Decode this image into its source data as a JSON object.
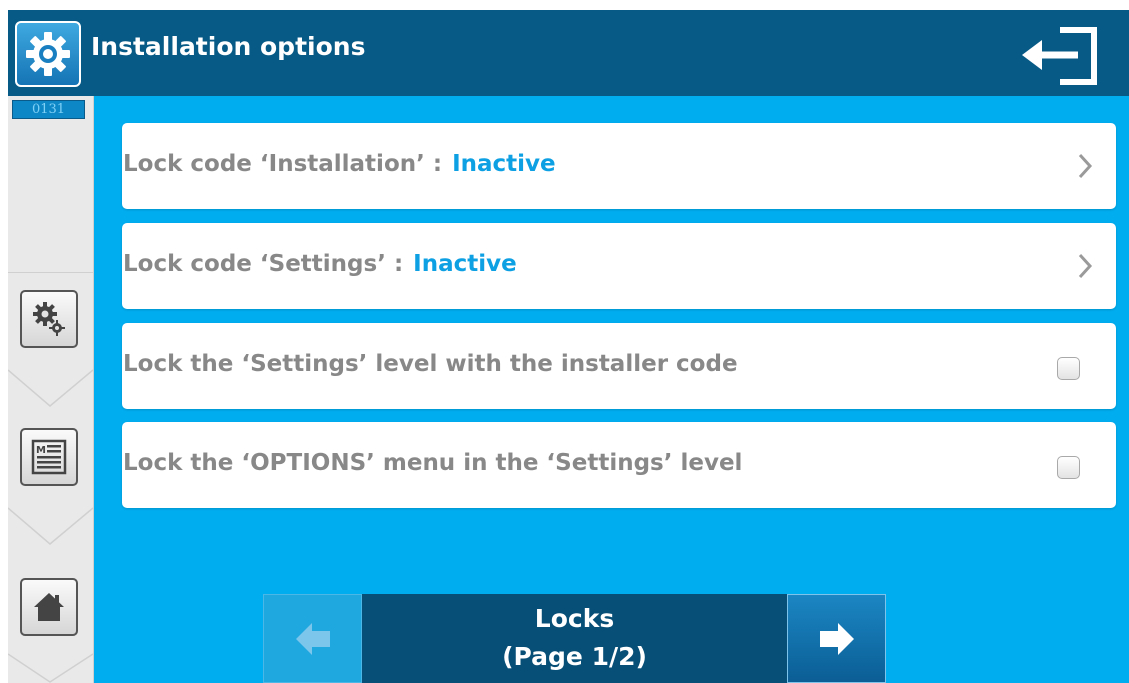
{
  "header": {
    "title": "Installation options",
    "settings_icon": "gear-icon",
    "exit_icon": "exit-icon"
  },
  "sidebar": {
    "code": "0131",
    "tabs": [
      {
        "name": "settings",
        "icon": "gears-icon"
      },
      {
        "name": "menu",
        "icon": "menu-list-icon"
      },
      {
        "name": "home",
        "icon": "home-icon"
      }
    ]
  },
  "options": [
    {
      "label": "Lock code ‘Installation’ :",
      "value": "Inactive",
      "control": "chevron"
    },
    {
      "label": "Lock code ‘Settings’ :",
      "value": "Inactive",
      "control": "chevron"
    },
    {
      "label": "Lock the ‘Settings’ level with the installer code",
      "checked": false,
      "control": "checkbox"
    },
    {
      "label": "Lock the ‘OPTIONS’ menu in the ‘Settings’ level",
      "checked": false,
      "control": "checkbox"
    }
  ],
  "pager": {
    "title": "Locks",
    "page": "(Page 1/2)"
  },
  "colors": {
    "background": "#00adef",
    "header": "#085a86",
    "value_text": "#0da0e3",
    "label_text": "#888888"
  }
}
